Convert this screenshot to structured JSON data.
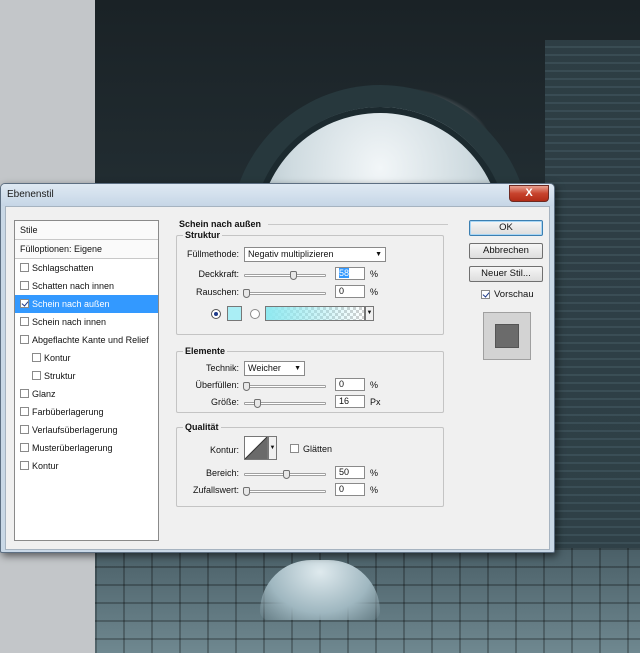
{
  "dialog": {
    "title": "Ebenenstil",
    "close_label": "X"
  },
  "styles_list": {
    "header": "Stile",
    "blend_options": "Fülloptionen: Eigene",
    "items": [
      {
        "label": "Schlagschatten",
        "checked": false,
        "selected": false,
        "indented": false
      },
      {
        "label": "Schatten nach innen",
        "checked": false,
        "selected": false,
        "indented": false
      },
      {
        "label": "Schein nach außen",
        "checked": true,
        "selected": true,
        "indented": false
      },
      {
        "label": "Schein nach innen",
        "checked": false,
        "selected": false,
        "indented": false
      },
      {
        "label": "Abgeflachte Kante und Relief",
        "checked": false,
        "selected": false,
        "indented": false
      },
      {
        "label": "Kontur",
        "checked": false,
        "selected": false,
        "indented": true
      },
      {
        "label": "Struktur",
        "checked": false,
        "selected": false,
        "indented": true
      },
      {
        "label": "Glanz",
        "checked": false,
        "selected": false,
        "indented": false
      },
      {
        "label": "Farbüberlagerung",
        "checked": false,
        "selected": false,
        "indented": false
      },
      {
        "label": "Verlaufsüberlagerung",
        "checked": false,
        "selected": false,
        "indented": false
      },
      {
        "label": "Musterüberlagerung",
        "checked": false,
        "selected": false,
        "indented": false
      },
      {
        "label": "Kontur",
        "checked": false,
        "selected": false,
        "indented": false
      }
    ]
  },
  "panel": {
    "heading": "Schein nach außen",
    "structure": {
      "title": "Struktur",
      "blend_mode_label": "Füllmethode:",
      "blend_mode_value": "Negativ multiplizieren",
      "opacity_label": "Deckkraft:",
      "opacity_value": "58",
      "opacity_unit": "%",
      "noise_label": "Rauschen:",
      "noise_value": "0",
      "noise_unit": "%",
      "glow_color": "#aaeef5",
      "gradient_from": "#8fe9f0"
    },
    "elements": {
      "title": "Elemente",
      "technique_label": "Technik:",
      "technique_value": "Weicher",
      "spread_label": "Überfüllen:",
      "spread_value": "0",
      "spread_unit": "%",
      "size_label": "Größe:",
      "size_value": "16",
      "size_unit": "Px"
    },
    "quality": {
      "title": "Qualität",
      "contour_label": "Kontur:",
      "antialias_label": "Glätten",
      "range_label": "Bereich:",
      "range_value": "50",
      "range_unit": "%",
      "jitter_label": "Zufallswert:",
      "jitter_value": "0",
      "jitter_unit": "%"
    }
  },
  "buttons": {
    "ok": "OK",
    "cancel": "Abbrechen",
    "new_style": "Neuer Stil...",
    "preview_label": "Vorschau"
  }
}
